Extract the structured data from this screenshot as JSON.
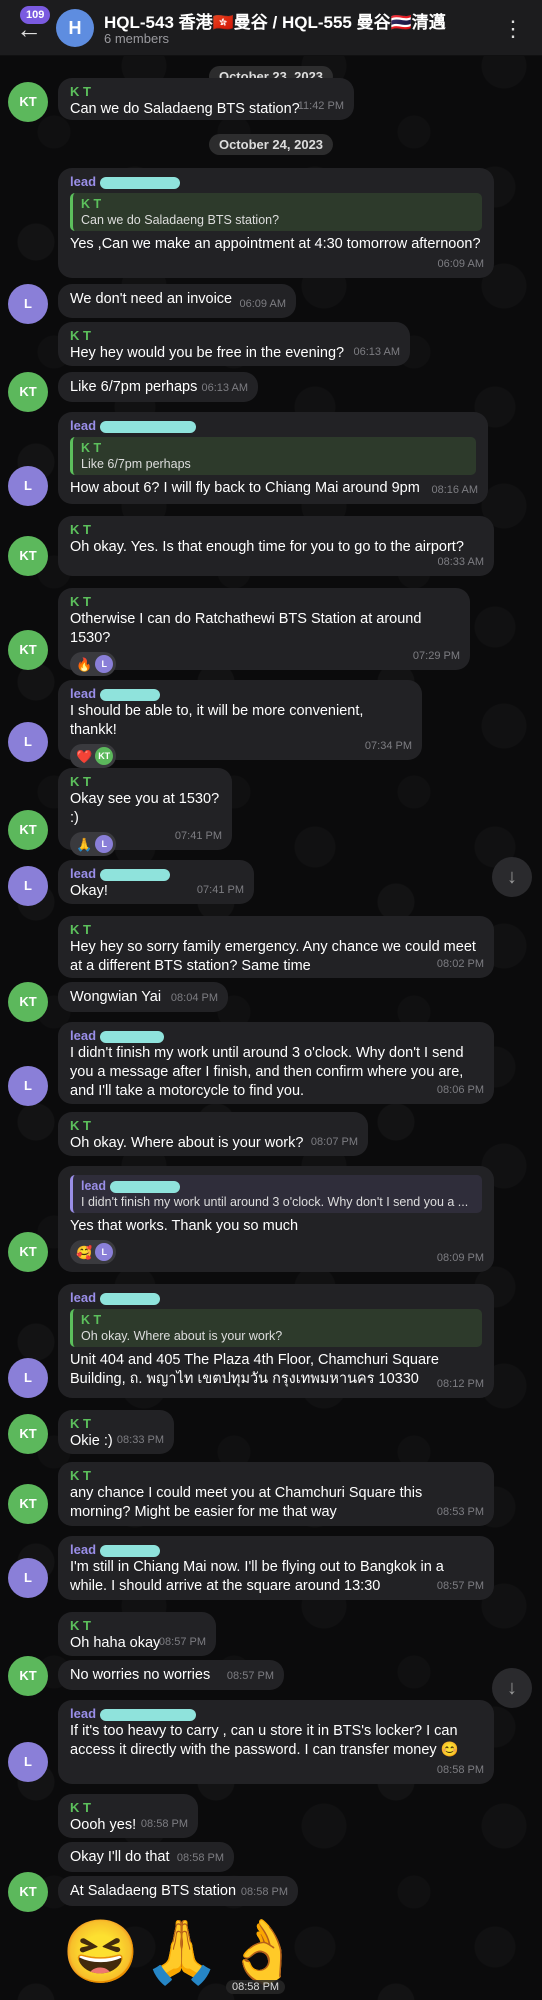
{
  "header": {
    "unread_count": "109",
    "avatar_letter": "H",
    "title": "HQL-543 香港🇭🇰曼谷 / HQL-555 曼谷🇹🇭清邁",
    "subtitle": "6 members"
  },
  "dates": {
    "d1": "October 23, 2023",
    "d2": "October 24, 2023"
  },
  "avatars": {
    "kt": "KT",
    "l": "L"
  },
  "names": {
    "kt": "K T",
    "lead": "lead"
  },
  "messages": {
    "m1": {
      "text": "Can we do Saladaeng BTS station?",
      "time": "11:42 PM"
    },
    "m2": {
      "reply_name": "K T",
      "reply_text": "Can we do Saladaeng BTS station?",
      "text": "Yes ,Can we make an appointment at 4:30 tomorrow afternoon?",
      "time": "06:09 AM"
    },
    "m3": {
      "text": "We don't need an invoice",
      "time": "06:09 AM"
    },
    "m4": {
      "text": "Hey hey would you be free in the evening?",
      "time": "06:13 AM"
    },
    "m5": {
      "text": "Like 6/7pm perhaps",
      "time": "06:13 AM"
    },
    "m6": {
      "reply_name": "K T",
      "reply_text": "Like 6/7pm perhaps",
      "text": "How about 6? I will fly back to Chiang Mai around 9pm",
      "time": "08:16 AM"
    },
    "m7": {
      "text": "Oh okay. Yes. Is that enough time for you to go to the airport?",
      "time": "08:33 AM"
    },
    "m8": {
      "text": "Otherwise I can do Ratchathewi BTS Station at around 1530?",
      "time": "07:29 PM",
      "reaction": "🔥"
    },
    "m9": {
      "text": "I should be able to, it will be more convenient, thankk!",
      "time": "07:34 PM",
      "reaction": "❤️"
    },
    "m10": {
      "text": "Okay see you at 1530? :)",
      "time": "07:41 PM",
      "reaction": "🙏"
    },
    "m11": {
      "text": "Okay!",
      "time": "07:41 PM"
    },
    "m12": {
      "text": "Hey hey so sorry family emergency. Any chance we could meet at a different BTS station? Same time",
      "time": "08:02 PM"
    },
    "m13": {
      "text": "Wongwian Yai",
      "time": "08:04 PM"
    },
    "m14": {
      "text": "I didn't finish my work until around 3 o'clock. Why don't I send you a message after I finish, and then confirm where you are, and I'll take a motorcycle to find you.",
      "time": "08:06 PM"
    },
    "m15": {
      "text": "Oh okay. Where about is your work?",
      "time": "08:07 PM"
    },
    "m16": {
      "reply_name": "lead",
      "reply_text": "I didn't finish my work until around 3 o'clock. Why don't I send you a ...",
      "text": "Yes that works. Thank you so much",
      "time": "08:09 PM",
      "reaction": "🥰"
    },
    "m17": {
      "reply_name": "K T",
      "reply_text": "Oh okay. Where about is your work?",
      "text": "Unit 404 and 405 The Plaza 4th Floor, Chamchuri Square Building, ถ. พญาไท เขตปทุมวัน กรุงเทพมหานคร 10330",
      "time": "08:12 PM"
    },
    "m18": {
      "text": "Okie :)",
      "time": "08:33 PM"
    },
    "m19": {
      "text": "any chance I could meet you at Chamchuri Square this morning? Might be easier for me that way",
      "time": "08:53 PM"
    },
    "m20": {
      "text": "I'm still in Chiang Mai now. I'll be flying out to Bangkok in a while. I should arrive at the square around 13:30",
      "time": "08:57 PM"
    },
    "m21": {
      "text": "Oh haha okay",
      "time": "08:57 PM"
    },
    "m22": {
      "text": "No worries no worries",
      "time": "08:57 PM"
    },
    "m23": {
      "text": "If it's too heavy to carry , can u store it in BTS's locker? I can access it directly with the password. I can transfer money 😊",
      "time": "08:58 PM"
    },
    "m24": {
      "text": "Oooh yes!",
      "time": "08:58 PM"
    },
    "m25": {
      "text": "Okay I'll do that",
      "time": "08:58 PM"
    },
    "m26": {
      "text": "At Saladaeng BTS station",
      "time": "08:58 PM"
    },
    "m27": {
      "emojis": "😆🙏👌",
      "time": "08:58 PM"
    }
  },
  "icons": {
    "back": "←",
    "menu": "⋮",
    "scroll_down": "↓"
  },
  "colors": {
    "kt_green": "#5cb85c",
    "lead_purple": "#8a7fd8",
    "bubble": "#222225",
    "background": "#0b0b0c"
  }
}
